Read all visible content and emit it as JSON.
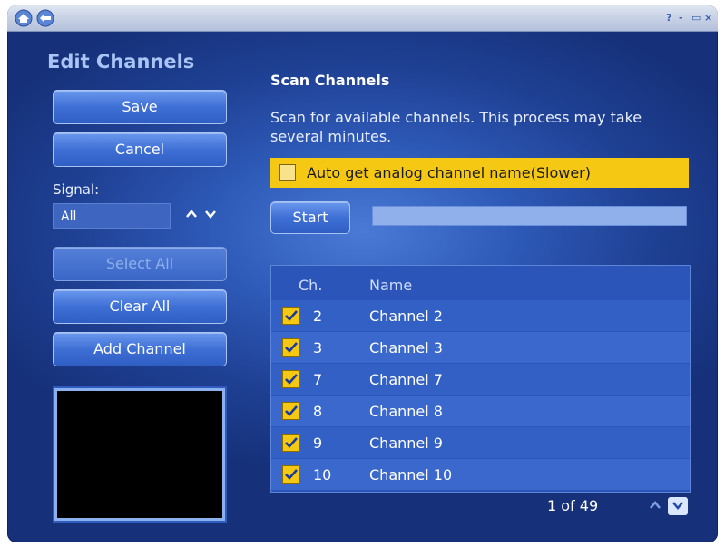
{
  "window": {
    "title_controls": {
      "help": "?",
      "minimize": "-",
      "restore": "▭",
      "close": "×"
    },
    "icons": [
      "home-icon",
      "back-arrow-icon"
    ]
  },
  "left_panel": {
    "title": "Edit Channels",
    "save_label": "Save",
    "cancel_label": "Cancel",
    "signal_label": "Signal:",
    "signal_value": "All",
    "select_all_label": "Select All",
    "clear_all_label": "Clear All",
    "add_channel_label": "Add Channel"
  },
  "scan": {
    "title": "Scan Channels",
    "description": "Scan for available channels. This process may take several minutes.",
    "auto_name_label": "Auto get analog channel name(Slower)",
    "auto_name_checked": false,
    "start_label": "Start",
    "progress": 0
  },
  "channel_list": {
    "columns": {
      "ch": "Ch.",
      "name": "Name"
    },
    "rows": [
      {
        "ch": "2",
        "name": "Channel 2",
        "checked": true
      },
      {
        "ch": "3",
        "name": "Channel 3",
        "checked": true
      },
      {
        "ch": "7",
        "name": "Channel 7",
        "checked": true
      },
      {
        "ch": "8",
        "name": "Channel 8",
        "checked": true
      },
      {
        "ch": "9",
        "name": "Channel 9",
        "checked": true
      },
      {
        "ch": "10",
        "name": "Channel 10",
        "checked": true
      }
    ],
    "pager": "1 of 49"
  },
  "colors": {
    "accent": "#f5c813",
    "background": "#2e5ab8",
    "button": "#3e6fd4"
  }
}
